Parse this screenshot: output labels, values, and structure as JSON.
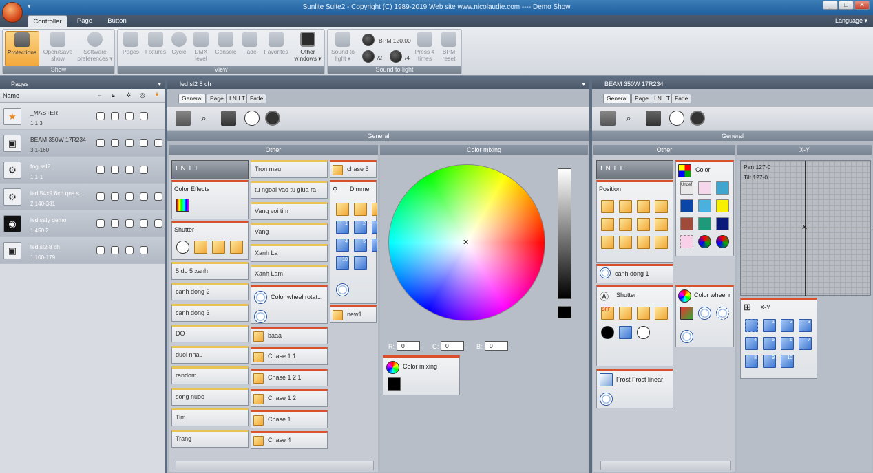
{
  "window": {
    "title": "Sunlite Suite2 - Copyright (C) 1989-2019    Web site www.nicolaudie.com ---- Demo Show",
    "min": "_",
    "max": "□",
    "close": "✕"
  },
  "qat": "▾",
  "menu_tabs": [
    {
      "label": "Controller"
    },
    {
      "label": "Page"
    },
    {
      "label": "Button"
    }
  ],
  "language": "Language ▾",
  "ribbon": {
    "groups": [
      {
        "label": "Show"
      },
      {
        "label": "View"
      },
      {
        "label": "Sound to light"
      }
    ],
    "show": [
      {
        "label": "Protections"
      },
      {
        "label": "Open/Save show"
      },
      {
        "label": "Software preferences ▾"
      }
    ],
    "view": [
      {
        "label": "Pages"
      },
      {
        "label": "Fixtures"
      },
      {
        "label": "Cycle"
      },
      {
        "label": "DMX level"
      },
      {
        "label": "Console"
      },
      {
        "label": "Fade"
      },
      {
        "label": "Favorites"
      },
      {
        "label": "Other windows ▾"
      }
    ],
    "sound": {
      "stl": "Sound to light ▾",
      "bpm": "BPM 120.00",
      "div2": "/2",
      "div4": "/4",
      "press4": "Press 4 times",
      "reset": "BPM reset"
    }
  },
  "pages_panel": {
    "title": "Pages",
    "col_name": "Name",
    "rows": [
      {
        "name": "_MASTER",
        "meta": "1   1   3",
        "icon": "★"
      },
      {
        "name": "BEAM 350W 17R234",
        "meta": "3   1-160",
        "icon": "▣"
      },
      {
        "name": "fog.ssl2",
        "meta": "1   1-1",
        "icon": "⚙"
      },
      {
        "name": "led 54x9 8ch qns.s...",
        "meta": "2   140-331",
        "icon": "⚙"
      },
      {
        "name": "led saly demo",
        "meta": "1   450   2",
        "icon": "◉"
      },
      {
        "name": "led sl2 8 ch",
        "meta": "1   100-179",
        "icon": "▣"
      }
    ]
  },
  "center_pane": {
    "title": "led sl2 8 ch",
    "subtabs": [
      "General",
      "Page",
      "I N I T",
      "Fade"
    ],
    "general": "General",
    "other": "Other",
    "color_mixing": "Color mixing",
    "col1": [
      "I N I T",
      "Color Effects",
      "Shutter",
      "5 do 5 xanh",
      "canh dong 2",
      "canh dong 3",
      "DO",
      "duoi nhau",
      "random",
      "song nuoc",
      "Tim",
      "Trang"
    ],
    "col2": [
      "Tron mau",
      "tu ngoai vao tu giua ra",
      "Vang voi tim",
      "Vang",
      "Xanh La",
      "Xanh Lam",
      "Color wheel rotat...",
      "baaa",
      "Chase 1 1",
      "Chase 1 2 1",
      "Chase 1 2",
      "Chase 1",
      "Chase 4"
    ],
    "col3": {
      "chase5": "chase 5",
      "dimmer": "Dimmer",
      "new1": "new1"
    },
    "nums": [
      "1",
      "2",
      "3",
      "4",
      "5",
      "6",
      "7",
      "8",
      "9",
      "10"
    ],
    "rgb": {
      "r_label": "R:",
      "g_label": "G:",
      "b_label": "B:",
      "r": "0",
      "g": "0",
      "b": "0"
    },
    "mix_box": "Color mixing"
  },
  "right_pane": {
    "title": "BEAM 350W 17R234",
    "subtabs": [
      "General",
      "Page",
      "I N I T",
      "Fade"
    ],
    "general": "General",
    "other": "Other",
    "xy": "X-Y",
    "init": "I N I T",
    "position": "Position",
    "canh": "canh dong 1",
    "shutter": "Shutter",
    "frost": "Frost Frost linear",
    "color": "Color",
    "undef": "Undef",
    "colorwheel": "Color wheel r",
    "off": "OFF",
    "pan": "Pan 127-0",
    "tilt": "Tilt 127-0",
    "xy_box": "X-Y",
    "swatches": [
      "#f6d6ea",
      "#3fa6d0",
      "#0a46a8",
      "#4ab0e0",
      "#f8f000",
      "#a04a3a",
      "#1e9a7a",
      "#0a1a7a"
    ]
  }
}
